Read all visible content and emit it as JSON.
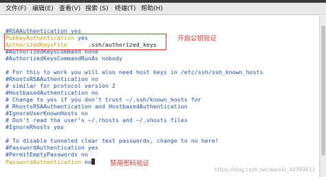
{
  "window": {
    "title_fragment": ""
  },
  "menu": [
    {
      "label": "文件(F)"
    },
    {
      "label": "编辑(E)"
    },
    {
      "label": "查看(V)"
    },
    {
      "label": "搜索 (S)"
    },
    {
      "label": "终端(T)"
    },
    {
      "label": "帮助(H)"
    }
  ],
  "lines": [
    "#RSAAuthentication yes",
    "PubkeyAuthentication yes",
    "AuthorizedKeysFile      .ssh/authorized_keys",
    "#AuthorizedKeysCommand none",
    "#AuthorizedKeysCommandRunAs nobody",
    "",
    "# For this to work you will also need host keys in /etc/ssh/ssh_known_hosts",
    "#RhostsRSAAuthentication no",
    "# similar for protocol version 2",
    "#HostbasedAuthentication no",
    "# Change to yes if you don't trust ~/.ssh/known_hosts for",
    "# RhostsRSAAuthentication and HostbasedAuthentication",
    "#IgnoreUserKnownHosts no",
    "# Don't read the user's ~/.rhosts and ~/.shosts files",
    "#IgnoreRhosts yes",
    "",
    "# To disable tunneled clear text passwords, change to no here!",
    "#PasswordAuthentication yes",
    "#PermitEmptyPasswords no",
    "PasswordAuthentication no"
  ],
  "line_parts": {
    "pubkey_key": "PubkeyAuthentication",
    "pubkey_val": " yes",
    "authkeys_key": "AuthorizedKeysFile",
    "authkeys_val": "      .ssh/authorized_keys",
    "password_key": "PasswordAuthentication",
    "password_val": " no"
  },
  "annotations": {
    "enable_pubkey": "开启公钥验证",
    "disable_password": "禁用密码验证"
  },
  "watermark": "https://blog.csdn.net/weixin_44769612",
  "colors": {
    "comment": "#1e4fa8",
    "directive": "#c39a00",
    "annotation": "#e0312b"
  }
}
